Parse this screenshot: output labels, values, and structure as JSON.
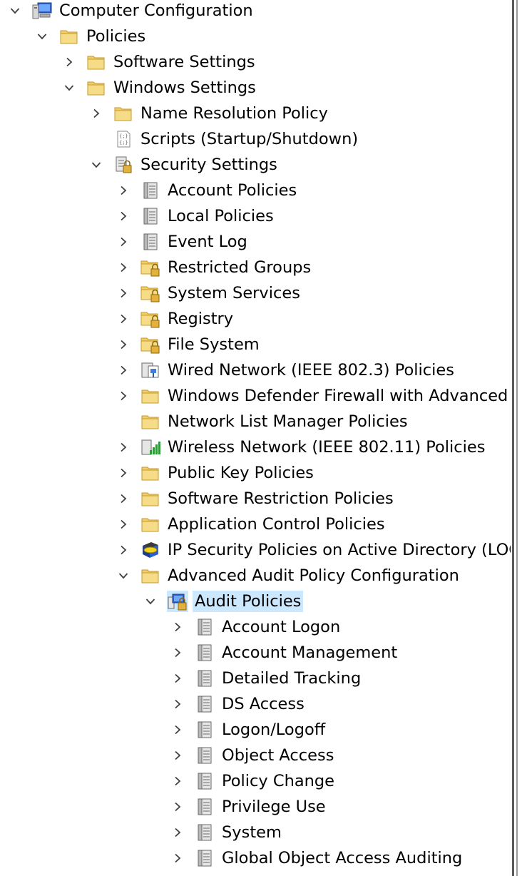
{
  "tree": {
    "items": [
      {
        "label": "Computer Configuration",
        "level": 0,
        "state": "expanded",
        "icon": "computer-icon"
      },
      {
        "label": "Policies",
        "level": 1,
        "state": "expanded",
        "icon": "folder-icon"
      },
      {
        "label": "Software Settings",
        "level": 2,
        "state": "collapsed",
        "icon": "folder-icon"
      },
      {
        "label": "Windows Settings",
        "level": 2,
        "state": "expanded",
        "icon": "folder-icon"
      },
      {
        "label": "Name Resolution Policy",
        "level": 3,
        "state": "collapsed",
        "icon": "folder-icon"
      },
      {
        "label": "Scripts (Startup/Shutdown)",
        "level": 3,
        "state": "leaf",
        "icon": "script-icon"
      },
      {
        "label": "Security Settings",
        "level": 3,
        "state": "expanded",
        "icon": "security-settings-icon"
      },
      {
        "label": "Account Policies",
        "level": 4,
        "state": "collapsed",
        "icon": "policy-book-icon"
      },
      {
        "label": "Local Policies",
        "level": 4,
        "state": "collapsed",
        "icon": "policy-book-icon"
      },
      {
        "label": "Event Log",
        "level": 4,
        "state": "collapsed",
        "icon": "policy-book-icon"
      },
      {
        "label": "Restricted Groups",
        "level": 4,
        "state": "collapsed",
        "icon": "locked-folder-icon"
      },
      {
        "label": "System Services",
        "level": 4,
        "state": "collapsed",
        "icon": "locked-folder-icon"
      },
      {
        "label": "Registry",
        "level": 4,
        "state": "collapsed",
        "icon": "locked-folder-icon"
      },
      {
        "label": "File System",
        "level": 4,
        "state": "collapsed",
        "icon": "locked-folder-icon"
      },
      {
        "label": "Wired Network (IEEE 802.3) Policies",
        "level": 4,
        "state": "collapsed",
        "icon": "wired-network-icon"
      },
      {
        "label": "Windows Defender Firewall with Advanced Se",
        "level": 4,
        "state": "collapsed",
        "icon": "folder-icon"
      },
      {
        "label": "Network List Manager Policies",
        "level": 4,
        "state": "leaf",
        "icon": "folder-icon"
      },
      {
        "label": "Wireless Network (IEEE 802.11) Policies",
        "level": 4,
        "state": "collapsed",
        "icon": "wireless-network-icon"
      },
      {
        "label": "Public Key Policies",
        "level": 4,
        "state": "collapsed",
        "icon": "folder-icon"
      },
      {
        "label": "Software Restriction Policies",
        "level": 4,
        "state": "collapsed",
        "icon": "folder-icon"
      },
      {
        "label": "Application Control Policies",
        "level": 4,
        "state": "collapsed",
        "icon": "folder-icon"
      },
      {
        "label": "IP Security Policies on Active Directory (LOGS",
        "level": 4,
        "state": "collapsed",
        "icon": "ip-security-icon"
      },
      {
        "label": "Advanced Audit Policy Configuration",
        "level": 4,
        "state": "expanded",
        "icon": "folder-icon"
      },
      {
        "label": "Audit Policies",
        "level": 5,
        "state": "expanded",
        "icon": "audit-policies-icon",
        "selected": true
      },
      {
        "label": "Account Logon",
        "level": 6,
        "state": "collapsed",
        "icon": "policy-book-icon"
      },
      {
        "label": "Account Management",
        "level": 6,
        "state": "collapsed",
        "icon": "policy-book-icon"
      },
      {
        "label": "Detailed Tracking",
        "level": 6,
        "state": "collapsed",
        "icon": "policy-book-icon"
      },
      {
        "label": "DS Access",
        "level": 6,
        "state": "collapsed",
        "icon": "policy-book-icon"
      },
      {
        "label": "Logon/Logoff",
        "level": 6,
        "state": "collapsed",
        "icon": "policy-book-icon"
      },
      {
        "label": "Object Access",
        "level": 6,
        "state": "collapsed",
        "icon": "policy-book-icon"
      },
      {
        "label": "Policy Change",
        "level": 6,
        "state": "collapsed",
        "icon": "policy-book-icon"
      },
      {
        "label": "Privilege Use",
        "level": 6,
        "state": "collapsed",
        "icon": "policy-book-icon"
      },
      {
        "label": "System",
        "level": 6,
        "state": "collapsed",
        "icon": "policy-book-icon"
      },
      {
        "label": "Global Object Access Auditing",
        "level": 6,
        "state": "collapsed",
        "icon": "policy-book-icon"
      }
    ]
  },
  "colors": {
    "selection": "#cce8ff",
    "folder": "#f0cf6a",
    "chevron": "#404040"
  }
}
